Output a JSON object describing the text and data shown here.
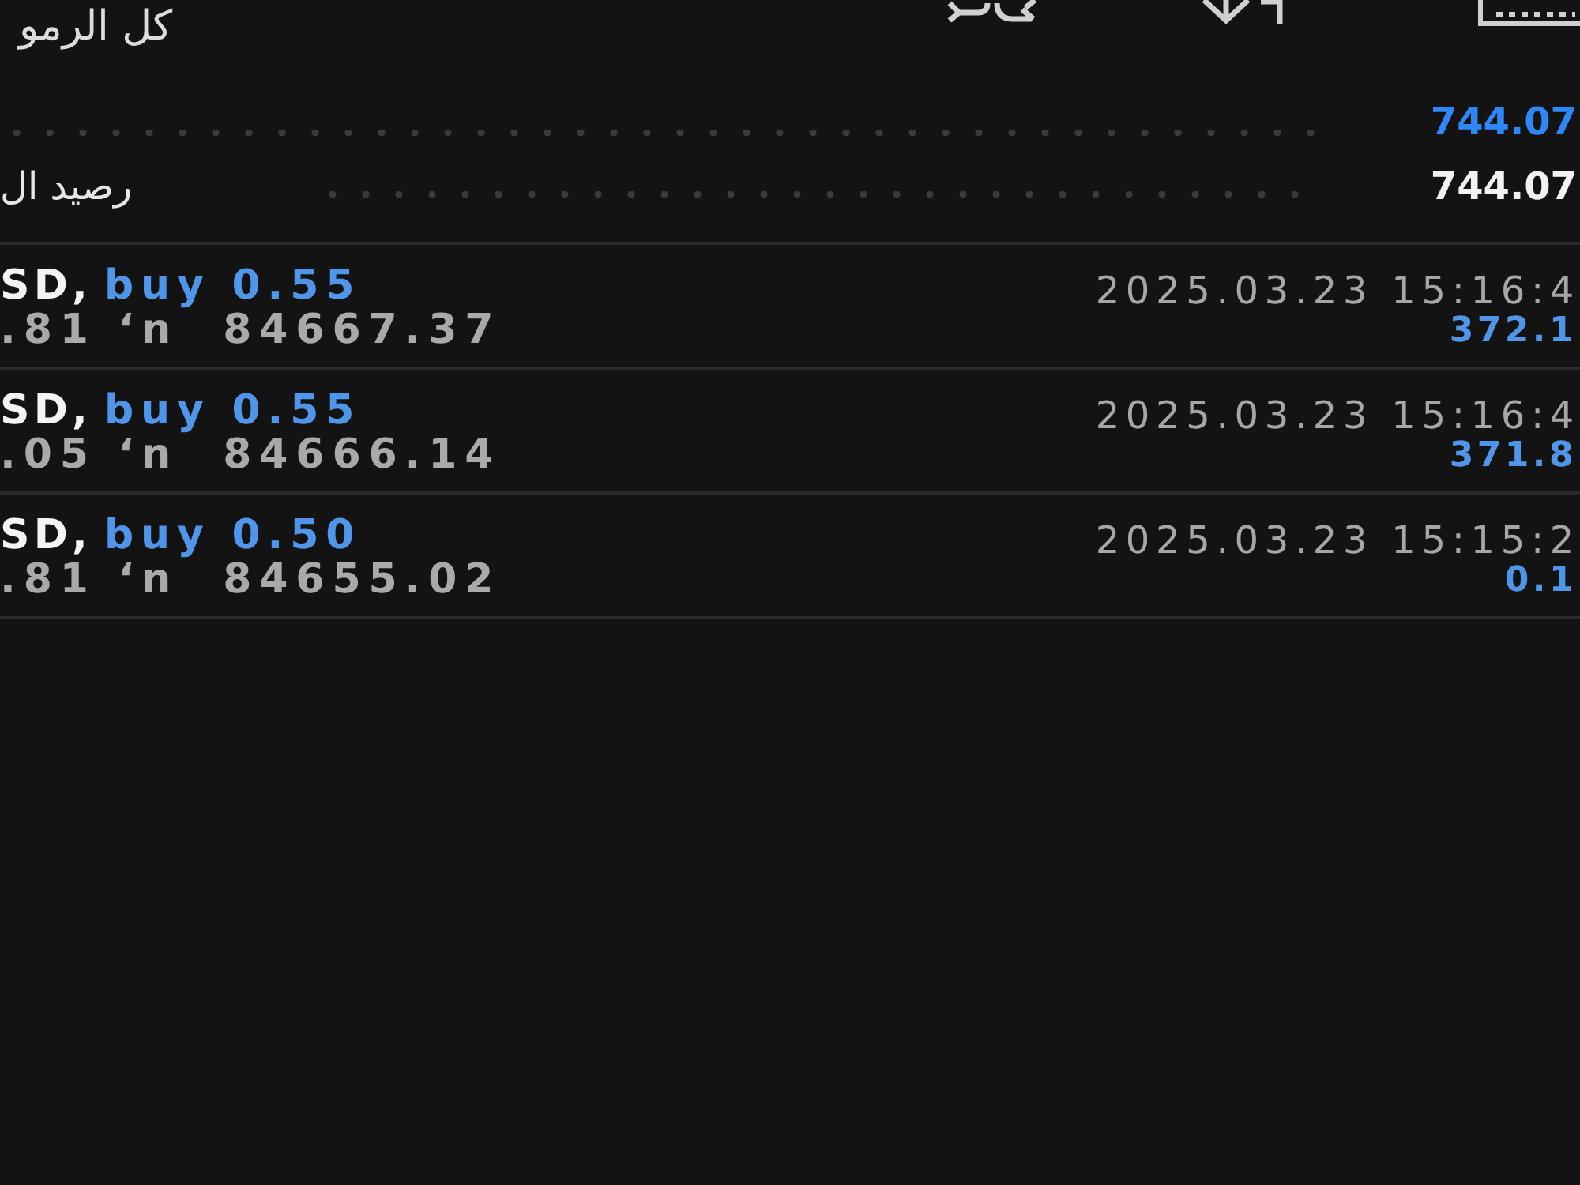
{
  "header": {
    "filter": "كل الرمو"
  },
  "summary": [
    {
      "kind": "accent",
      "value": "744.07"
    },
    {
      "kind": "plain",
      "label": "رصيد ال",
      "value": "744.07"
    }
  ],
  "deals": [
    {
      "symbol": "SD,",
      "side": "buy 0.55",
      "prices": ".81 ‘n  84667.37",
      "time": "2025.03.23 15:16:4",
      "profit": "372.1"
    },
    {
      "symbol": "SD,",
      "side": "buy 0.55",
      "prices": ".05 ‘n  84666.14",
      "time": "2025.03.23 15:16:4",
      "profit": "371.8"
    },
    {
      "symbol": "SD,",
      "side": "buy 0.50",
      "prices": ".81 ‘n  84655.02",
      "time": "2025.03.23 15:15:2",
      "profit": "0.1"
    }
  ]
}
